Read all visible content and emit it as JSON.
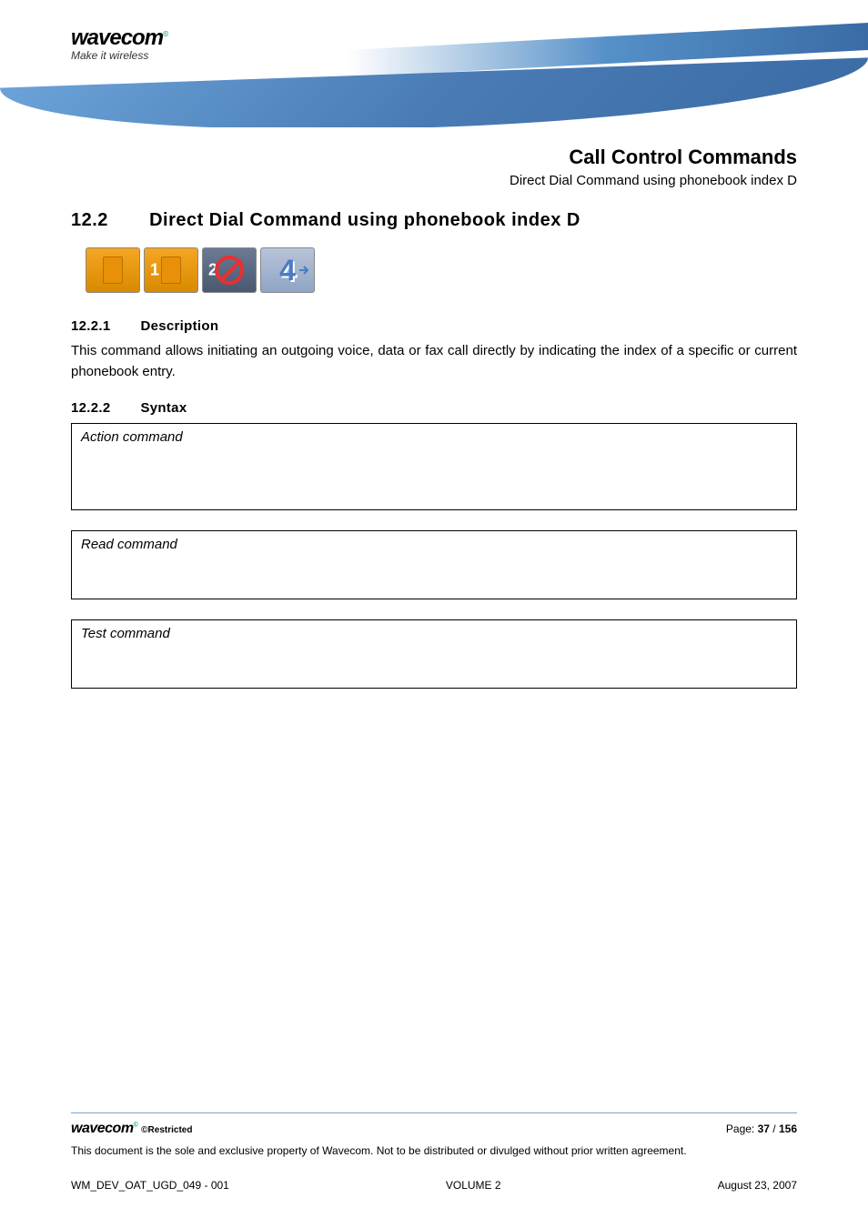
{
  "header": {
    "logo": "wavecom",
    "tagline": "Make it wireless"
  },
  "chapter": {
    "title": "Call Control Commands",
    "subtitle": "Direct Dial Command using phonebook index D"
  },
  "section": {
    "number": "12.2",
    "title": "Direct Dial Command using phonebook index D"
  },
  "icons": [
    {
      "name": "sim",
      "badge": ""
    },
    {
      "name": "sim",
      "badge": "1"
    },
    {
      "name": "disabled",
      "badge": "2"
    },
    {
      "name": "num4",
      "badge": ""
    }
  ],
  "subsections": {
    "description": {
      "number": "12.2.1",
      "title": "Description",
      "text": "This command allows initiating an outgoing voice, data or fax call directly by indicating the index of a specific or current phonebook entry."
    },
    "syntax": {
      "number": "12.2.2",
      "title": "Syntax",
      "boxes": [
        {
          "label": "Action command"
        },
        {
          "label": "Read command"
        },
        {
          "label": "Test command"
        }
      ]
    }
  },
  "footer": {
    "logo": "wavecom",
    "restricted": "©Restricted",
    "page_label": "Page: ",
    "page_current": "37",
    "page_sep": " / ",
    "page_total": "156",
    "notice": "This document is the sole and exclusive property of Wavecom. Not to be distributed or divulged without prior written agreement.",
    "doc_id": "WM_DEV_OAT_UGD_049 - 001",
    "volume": "VOLUME 2",
    "date": "August 23, 2007"
  }
}
